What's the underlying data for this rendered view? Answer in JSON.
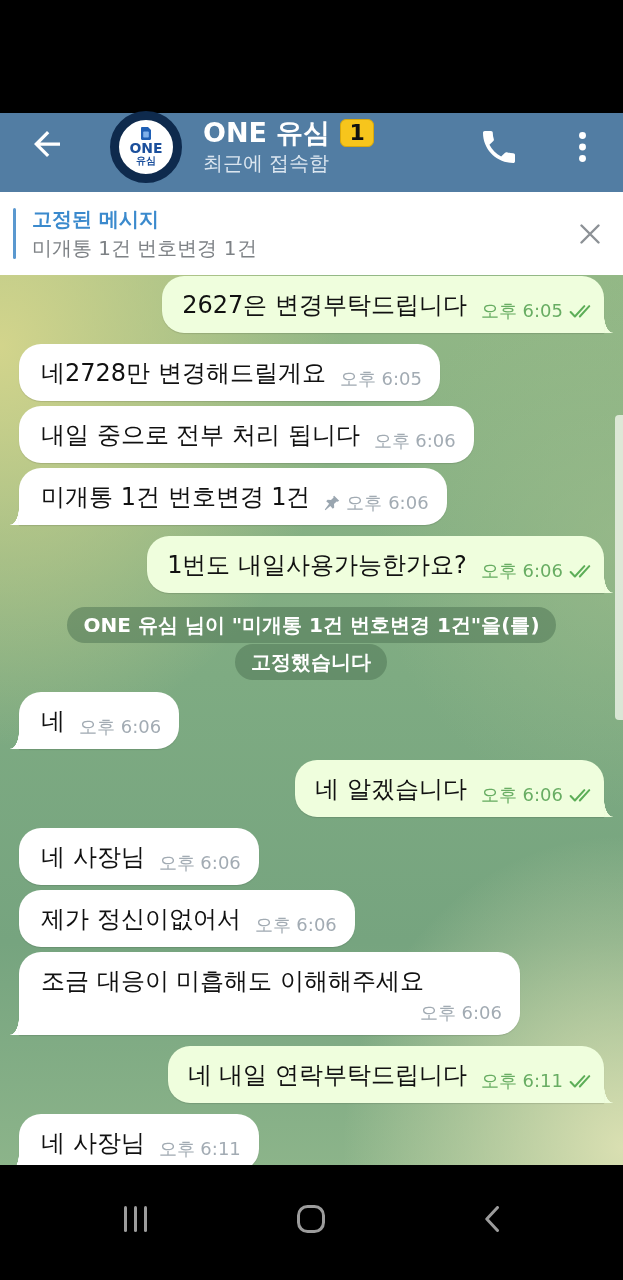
{
  "header": {
    "title": "ONE 유심",
    "badge": "1",
    "subtitle": "최근에 접속함",
    "avatar": {
      "title": "ONE",
      "subtitle": "유심"
    }
  },
  "pinned": {
    "title": "고정된 메시지",
    "text": "미개통 1건 번호변경 1건"
  },
  "messages": [
    {
      "kind": "outgoing",
      "text": "2627은 변경부탁드립니다",
      "time": "오후 6:05",
      "read": true,
      "pinned": false
    },
    {
      "kind": "incoming",
      "text": "네2728만 변경해드릴게요",
      "time": "오후 6:05",
      "pinned": false
    },
    {
      "kind": "incoming",
      "text": "내일 중으로 전부 처리 됩니다",
      "time": "오후 6:06",
      "pinned": false
    },
    {
      "kind": "incoming",
      "text": "미개통 1건 번호변경 1건",
      "time": "오후 6:06",
      "pinned": true
    },
    {
      "kind": "outgoing",
      "text": "1번도 내일사용가능한가요?",
      "time": "오후 6:06",
      "read": true,
      "pinned": false
    },
    {
      "kind": "service",
      "lines": [
        "ONE 유심 님이 \"미개통 1건 번호변경 1건\"을(를)",
        "고정했습니다"
      ]
    },
    {
      "kind": "incoming",
      "text": "네",
      "time": "오후 6:06",
      "pinned": false
    },
    {
      "kind": "outgoing",
      "text": "네 알겠습니다",
      "time": "오후 6:06",
      "read": true,
      "pinned": false
    },
    {
      "kind": "incoming",
      "text": "네 사장님",
      "time": "오후 6:06",
      "pinned": false
    },
    {
      "kind": "incoming",
      "text": "제가 정신이없어서",
      "time": "오후 6:06",
      "pinned": false
    },
    {
      "kind": "incoming",
      "text": "조금 대응이 미흡해도 이해해주세요",
      "time": "오후 6:06",
      "pinned": false
    },
    {
      "kind": "outgoing",
      "text": "네 내일 연락부탁드립니다",
      "time": "오후 6:11",
      "read": true,
      "pinned": false
    },
    {
      "kind": "incoming",
      "text": "네 사장님",
      "time": "오후 6:11",
      "pinned": false
    }
  ]
}
